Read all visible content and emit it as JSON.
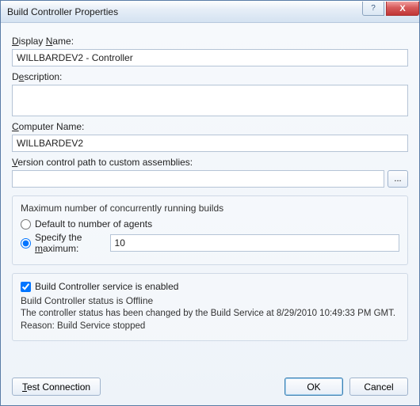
{
  "title": "Build Controller Properties",
  "labels": {
    "display_name": "Display Name:",
    "description": "Description:",
    "computer_name": "Computer Name:",
    "vc_path": "Version control path to custom assemblies:",
    "max_builds_group": "Maximum number of concurrently running builds",
    "radio_default": "Default to number of agents",
    "radio_specify": "Specify the maximum:",
    "enabled_check": "Build Controller service is enabled",
    "status_header": "Build Controller status is Offline",
    "status_line1": "The controller status has been changed by the Build Service at 8/29/2010 10:49:33 PM GMT.",
    "status_line2": "Reason: Build Service stopped"
  },
  "values": {
    "display_name": "WILLBARDEV2 - Controller",
    "description": "",
    "computer_name": "WILLBARDEV2",
    "vc_path": "",
    "max_value": "10"
  },
  "buttons": {
    "browse": "...",
    "test": "Test Connection",
    "ok": "OK",
    "cancel": "Cancel",
    "help": "?",
    "close": "X"
  }
}
